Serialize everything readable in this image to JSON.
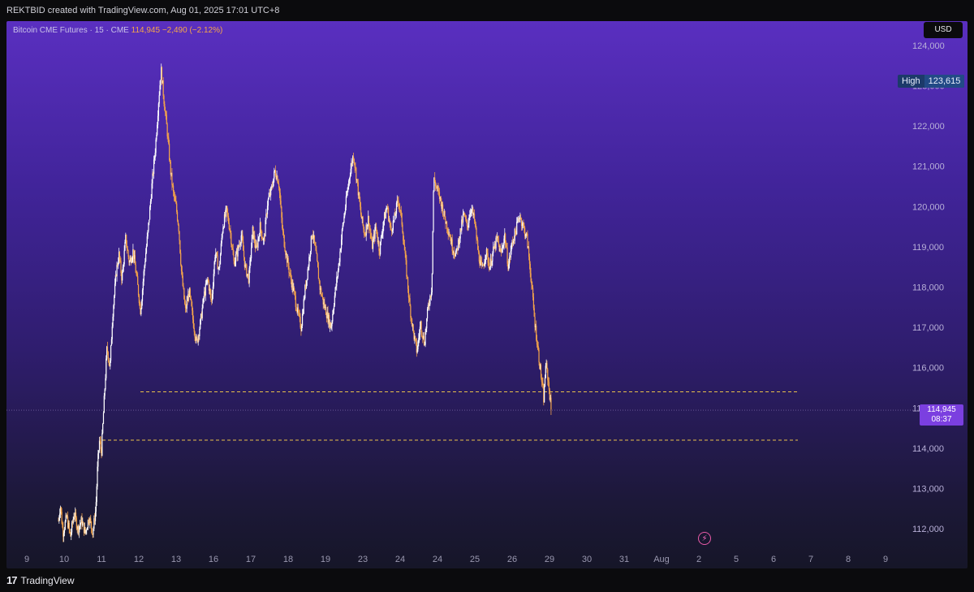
{
  "header": {
    "credit": "REKTBID created with TradingView.com, Aug 01, 2025 17:01 UTC+8"
  },
  "symbol": {
    "name": "Bitcoin CME Futures",
    "interval": "15",
    "exchange": "CME",
    "last": "114,945",
    "change": "−2,490 (−2.12%)"
  },
  "currency_button": "USD",
  "high_marker": {
    "label": "High",
    "value": "123,615"
  },
  "price_tag": {
    "price": "114,945",
    "countdown": "08:37"
  },
  "footer": {
    "logo_mark": "17",
    "brand": "TradingView"
  },
  "colors": {
    "candle_up": "#ffffff",
    "candle_down": "#f5a54a",
    "level_line": "#e8c04a",
    "accent": "#7b3fe0"
  },
  "icons": {
    "alert": "lightning-icon"
  },
  "chart_data": {
    "type": "candlestick",
    "ylim": [
      111500,
      124400
    ],
    "y_ticks": [
      "112,000",
      "113,000",
      "114,000",
      "115,000",
      "116,000",
      "117,000",
      "118,000",
      "119,000",
      "120,000",
      "121,000",
      "122,000",
      "123,000",
      "124,000"
    ],
    "y_tick_values": [
      112000,
      113000,
      114000,
      115000,
      116000,
      117000,
      118000,
      119000,
      120000,
      121000,
      122000,
      123000,
      124000
    ],
    "x_ticks": [
      "9",
      "10",
      "11",
      "12",
      "13",
      "16",
      "17",
      "18",
      "19",
      "23",
      "24",
      "24",
      "25",
      "26",
      "29",
      "30",
      "31",
      "Aug",
      "2",
      "5",
      "6",
      "7",
      "8",
      "9"
    ],
    "x_tick_index": [
      -1,
      0,
      1,
      2,
      3,
      4,
      5,
      6,
      7,
      8,
      9,
      10,
      11,
      12,
      13,
      14,
      15,
      16,
      17,
      18,
      19,
      20,
      21,
      22
    ],
    "price_path": [
      [
        0.0,
        112.2
      ],
      [
        0.05,
        112.6
      ],
      [
        0.12,
        111.9
      ],
      [
        0.22,
        112.3
      ],
      [
        0.32,
        111.8
      ],
      [
        0.42,
        112.4
      ],
      [
        0.52,
        112.0
      ],
      [
        0.62,
        112.2
      ],
      [
        0.72,
        111.9
      ],
      [
        0.82,
        112.3
      ],
      [
        0.92,
        111.9
      ],
      [
        1.0,
        112.5
      ],
      [
        1.05,
        113.6
      ],
      [
        1.1,
        114.2
      ],
      [
        1.15,
        113.9
      ],
      [
        1.3,
        116.5
      ],
      [
        1.38,
        116.0
      ],
      [
        1.45,
        117.3
      ],
      [
        1.55,
        118.4
      ],
      [
        1.62,
        118.8
      ],
      [
        1.7,
        118.2
      ],
      [
        1.8,
        119.2
      ],
      [
        1.9,
        118.6
      ],
      [
        2.0,
        118.9
      ],
      [
        2.1,
        118.2
      ],
      [
        2.2,
        117.4
      ],
      [
        2.3,
        118.5
      ],
      [
        2.4,
        119.4
      ],
      [
        2.5,
        120.5
      ],
      [
        2.6,
        121.5
      ],
      [
        2.68,
        122.6
      ],
      [
        2.75,
        123.4
      ],
      [
        2.82,
        122.7
      ],
      [
        2.92,
        121.8
      ],
      [
        3.0,
        120.9
      ],
      [
        3.08,
        120.3
      ],
      [
        3.15,
        120.0
      ],
      [
        3.22,
        119.5
      ],
      [
        3.3,
        118.3
      ],
      [
        3.4,
        117.4
      ],
      [
        3.5,
        117.9
      ],
      [
        3.6,
        117.2
      ],
      [
        3.7,
        116.6
      ],
      [
        3.8,
        117.1
      ],
      [
        3.9,
        117.8
      ],
      [
        4.0,
        118.2
      ],
      [
        4.1,
        117.6
      ],
      [
        4.2,
        118.9
      ],
      [
        4.3,
        118.4
      ],
      [
        4.4,
        119.5
      ],
      [
        4.5,
        119.9
      ],
      [
        4.6,
        119.4
      ],
      [
        4.7,
        118.6
      ],
      [
        4.8,
        118.9
      ],
      [
        4.9,
        119.3
      ],
      [
        5.0,
        118.5
      ],
      [
        5.1,
        118.2
      ],
      [
        5.2,
        119.4
      ],
      [
        5.3,
        118.9
      ],
      [
        5.4,
        119.5
      ],
      [
        5.5,
        119.1
      ],
      [
        5.6,
        120.1
      ],
      [
        5.7,
        120.4
      ],
      [
        5.8,
        120.9
      ],
      [
        5.9,
        120.6
      ],
      [
        6.0,
        119.4
      ],
      [
        6.1,
        118.8
      ],
      [
        6.2,
        118.3
      ],
      [
        6.3,
        117.9
      ],
      [
        6.4,
        117.4
      ],
      [
        6.5,
        117.0
      ],
      [
        6.6,
        117.9
      ],
      [
        6.7,
        118.6
      ],
      [
        6.8,
        119.4
      ],
      [
        6.9,
        118.8
      ],
      [
        7.0,
        118.0
      ],
      [
        7.1,
        117.6
      ],
      [
        7.2,
        117.3
      ],
      [
        7.3,
        117.0
      ],
      [
        7.4,
        117.8
      ],
      [
        7.5,
        118.5
      ],
      [
        7.6,
        119.4
      ],
      [
        7.7,
        120.1
      ],
      [
        7.8,
        120.8
      ],
      [
        7.9,
        121.3
      ],
      [
        8.0,
        120.6
      ],
      [
        8.1,
        119.8
      ],
      [
        8.2,
        119.3
      ],
      [
        8.3,
        119.7
      ],
      [
        8.4,
        119.0
      ],
      [
        8.5,
        119.5
      ],
      [
        8.6,
        118.9
      ],
      [
        8.7,
        119.6
      ],
      [
        8.8,
        120.0
      ],
      [
        8.9,
        119.4
      ],
      [
        9.0,
        119.7
      ],
      [
        9.1,
        120.2
      ],
      [
        9.2,
        119.6
      ],
      [
        9.3,
        118.6
      ],
      [
        9.4,
        117.6
      ],
      [
        9.5,
        116.9
      ],
      [
        9.6,
        116.4
      ],
      [
        9.7,
        117.1
      ],
      [
        9.8,
        116.6
      ],
      [
        9.9,
        117.5
      ],
      [
        10.0,
        118.0
      ],
      [
        10.05,
        120.7
      ],
      [
        10.15,
        120.4
      ],
      [
        10.25,
        120.1
      ],
      [
        10.35,
        119.7
      ],
      [
        10.45,
        119.4
      ],
      [
        10.55,
        119.0
      ],
      [
        10.65,
        118.8
      ],
      [
        10.75,
        119.3
      ],
      [
        10.85,
        119.8
      ],
      [
        10.95,
        119.5
      ],
      [
        11.05,
        120.0
      ],
      [
        11.15,
        119.6
      ],
      [
        11.25,
        118.8
      ],
      [
        11.35,
        118.4
      ],
      [
        11.45,
        118.9
      ],
      [
        11.55,
        118.5
      ],
      [
        11.65,
        118.9
      ],
      [
        11.75,
        119.2
      ],
      [
        11.85,
        118.8
      ],
      [
        11.95,
        119.3
      ],
      [
        12.05,
        118.5
      ],
      [
        12.15,
        119.1
      ],
      [
        12.25,
        119.4
      ],
      [
        12.35,
        119.8
      ],
      [
        12.45,
        119.5
      ],
      [
        12.55,
        119.2
      ],
      [
        12.65,
        118.3
      ],
      [
        12.75,
        117.2
      ],
      [
        12.85,
        116.4
      ],
      [
        12.95,
        115.6
      ],
      [
        13.0,
        115.2
      ],
      [
        13.05,
        116.1
      ],
      [
        13.1,
        115.8
      ],
      [
        13.15,
        115.4
      ],
      [
        13.2,
        114.9
      ]
    ],
    "levels": [
      115.4,
      114.2
    ]
  }
}
